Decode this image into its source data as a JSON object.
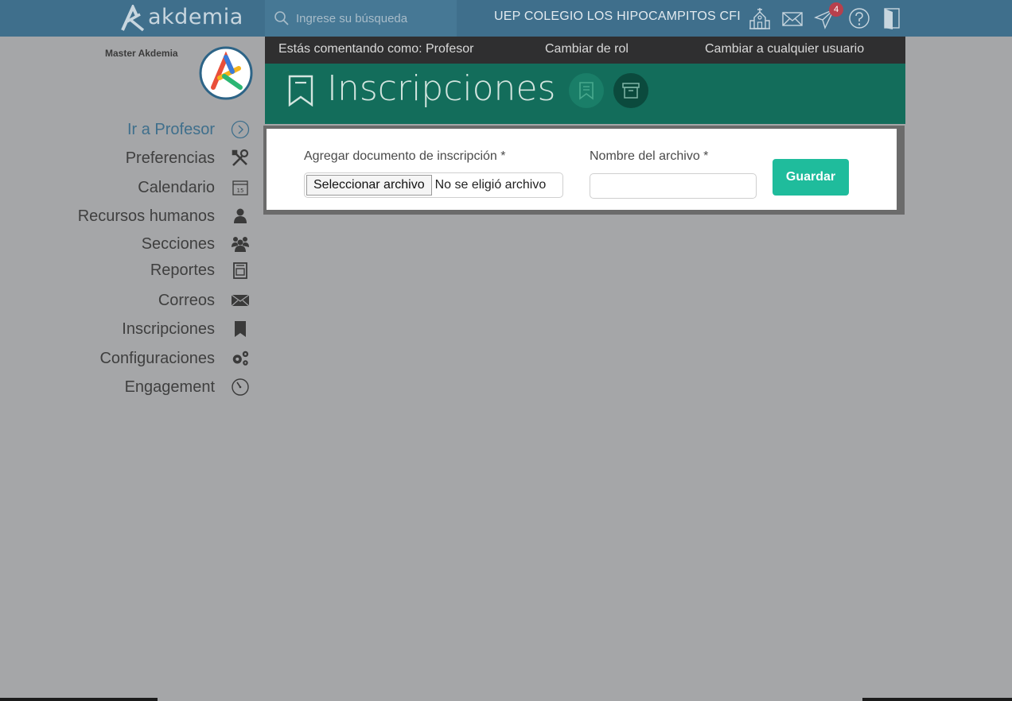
{
  "brand": {
    "name": "akdemia"
  },
  "search": {
    "placeholder": "Ingrese su búsqueda"
  },
  "header": {
    "school": "UEP COLEGIO LOS HIPOCAMPITOS CFI",
    "notifications_count": "4",
    "icons": [
      "school-building-icon",
      "mail-icon",
      "paper-plane-icon",
      "help-icon",
      "logout-door-icon"
    ]
  },
  "user": {
    "name": "Master Akdemia"
  },
  "sidebar": {
    "items": [
      {
        "label": "Ir a Profesor",
        "icon": "chevron-right-circle-icon",
        "active": true
      },
      {
        "label": "Preferencias",
        "icon": "tools-icon"
      },
      {
        "label": "Calendario",
        "icon": "calendar-icon"
      },
      {
        "label": "Recursos humanos",
        "icon": "person-icon"
      },
      {
        "label": "Secciones",
        "icon": "group-icon"
      },
      {
        "label": "Reportes",
        "icon": "report-icon"
      },
      {
        "label": "Correos",
        "icon": "envelope-icon"
      },
      {
        "label": "Inscripciones",
        "icon": "bookmark-icon"
      },
      {
        "label": "Configuraciones",
        "icon": "gears-icon"
      },
      {
        "label": "Engagement",
        "icon": "timer-icon"
      }
    ]
  },
  "rolebar": {
    "commenting_as": "Estás comentando como: Profesor",
    "change_role": "Cambiar de rol",
    "change_user": "Cambiar a cualquier usuario"
  },
  "page": {
    "title": "Inscripciones"
  },
  "form": {
    "doc_label": "Agregar documento de inscripción *",
    "file_button": "Seleccionar archivo",
    "file_status": "No se eligió archivo",
    "name_label": "Nombre del archivo *",
    "name_value": "",
    "save_label": "Guardar"
  },
  "colors": {
    "topbar": "#3f6f8c",
    "header": "#136d5b",
    "accent": "#1fbc9c",
    "rolebar": "#2f2f30"
  }
}
